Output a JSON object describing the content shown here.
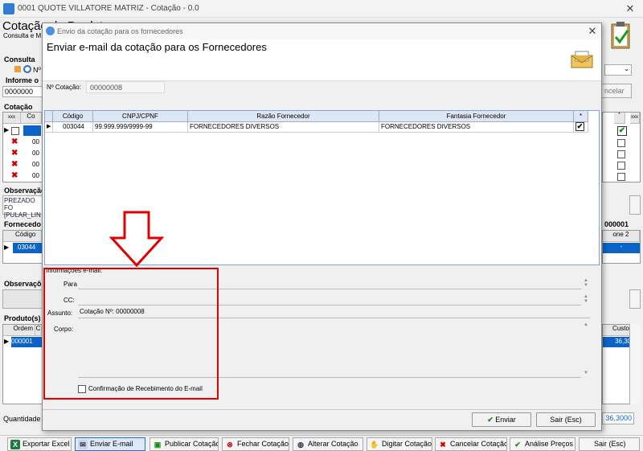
{
  "main": {
    "window_title": "0001 QUOTE VILLATORE MATRIZ - Cotação - 0.0",
    "page_title": "Cotação de Produtos",
    "subtitle": "Consulta e M",
    "consulta_label": "Consulta",
    "informe_label": "Informe o",
    "informe_value": "0000000",
    "cotacao_label": "Cotação",
    "cancel_fragment": "ncelar",
    "grid_rows": [
      "00",
      "00",
      "00",
      "00"
    ],
    "observacao_label": "Observação",
    "observacao_text1": "PREZADO FO",
    "observacao_text2": "[PULAR_LIN",
    "fornecedor_label": "Fornecedo",
    "fornecedor_code_right": "000001",
    "forn_header_codigo": "Código",
    "forn_header_right": "one 2",
    "forn_row_code": "03044",
    "forn_row_right": "-",
    "observacao2_label": "Observaçõ",
    "produtos_label": "Produto(s)",
    "prod_hdr_ordem": "Ordem",
    "prod_hdr_c": "C",
    "prod_hdr_custo": "Custo",
    "prod_row_ordem": "000001",
    "prod_row_custo": "36,3000",
    "quantidade_label": "Quantidade",
    "quantidade_value": "36,3000",
    "radio_label": "Nº"
  },
  "toolbar": {
    "exportar": "Exportar Excel",
    "enviar": "Enviar E-mail",
    "publicar": "Publicar Cotação",
    "fechar": "Fechar Cotação",
    "alterar": "Alterar Cotação",
    "digitar": "Digitar Cotação",
    "cancelar": "Cancelar Cotação",
    "analise": "Análise Preços",
    "sair": "Sair (Esc)"
  },
  "dialog": {
    "window_title": "Envio da cotação para os fornecedores",
    "heading": "Enviar e-mail da cotação para os Fornecedores",
    "cotacao_label": "Nº Cotação:",
    "cotacao_value": "00000008",
    "grid_headers": [
      "Código",
      "CNPJ/CPNF",
      "Razão Fornecedor",
      "Fantasia Fornecedor",
      "*"
    ],
    "grid_row": {
      "codigo": "003044",
      "cnpj": "99.999.999/9999-99",
      "razao": "FORNECEDORES DIVERSOS",
      "fantasia": "FORNECEDORES DIVERSOS",
      "checked": "✔"
    },
    "email_group_label": "Informações e-mail:",
    "para_label": "Para",
    "cc_label": "CC:",
    "assunto_label": "Assunto:",
    "assunto_value": "Cotação Nº: 00000008",
    "corpo_label": "Corpo:",
    "confirmacao_label": "Confirmação de Recebimento do E-mail",
    "enviar_button": "Enviar",
    "sair_button": "Sair (Esc)"
  },
  "colors": {
    "annotation_red": "#e00000",
    "selection_blue": "#0a64c8"
  }
}
